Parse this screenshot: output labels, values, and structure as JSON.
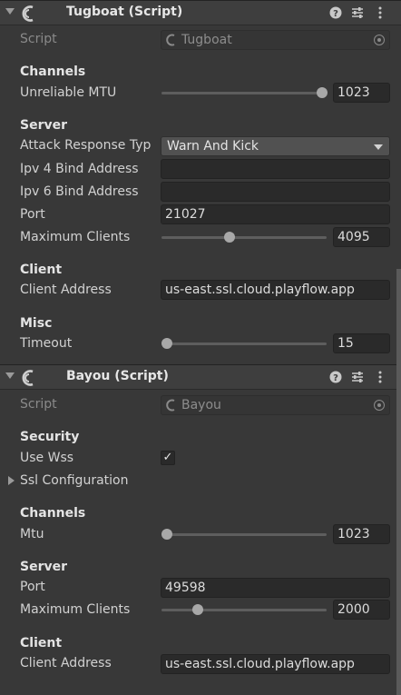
{
  "components": {
    "tugboat": {
      "title": "Tugboat (Script)",
      "script_label": "Script",
      "script_value": "Tugboat",
      "channels_heading": "Channels",
      "unreliable_mtu": {
        "label": "Unreliable MTU",
        "value": "1023",
        "fraction": 1.0
      },
      "server_heading": "Server",
      "attack_response": {
        "label": "Attack Response Typ",
        "value": "Warn And Kick"
      },
      "ipv4": {
        "label": "Ipv 4 Bind Address",
        "value": ""
      },
      "ipv6": {
        "label": "Ipv 6 Bind Address",
        "value": ""
      },
      "port": {
        "label": "Port",
        "value": "21027"
      },
      "max_clients": {
        "label": "Maximum Clients",
        "value": "4095",
        "fraction": 0.4
      },
      "client_heading": "Client",
      "client_address": {
        "label": "Client Address",
        "value": "us-east.ssl.cloud.playflow.app"
      },
      "misc_heading": "Misc",
      "timeout": {
        "label": "Timeout",
        "value": "15",
        "fraction": 0.0
      }
    },
    "bayou": {
      "title": "Bayou (Script)",
      "script_label": "Script",
      "script_value": "Bayou",
      "security_heading": "Security",
      "use_wss": {
        "label": "Use Wss",
        "checked": "✓"
      },
      "ssl_configuration": "Ssl Configuration",
      "channels_heading": "Channels",
      "mtu": {
        "label": "Mtu",
        "value": "1023",
        "fraction": 0.0
      },
      "server_heading": "Server",
      "port": {
        "label": "Port",
        "value": "49598"
      },
      "max_clients": {
        "label": "Maximum Clients",
        "value": "2000",
        "fraction": 0.2
      },
      "client_heading": "Client",
      "client_address": {
        "label": "Client Address",
        "value": "us-east.ssl.cloud.playflow.app"
      }
    }
  },
  "icons": [
    "component-logo-icon",
    "help-icon",
    "presets-icon",
    "kebab-menu-icon",
    "script-icon",
    "object-picker-icon",
    "checkmark-icon",
    "foldout-arrow-icon"
  ],
  "colors": {
    "background": "#383838",
    "header": "#3e3e3e",
    "field": "#2a2a2a",
    "slider_track": "#5e5e5e",
    "slider_thumb": "#a8a8a8"
  }
}
